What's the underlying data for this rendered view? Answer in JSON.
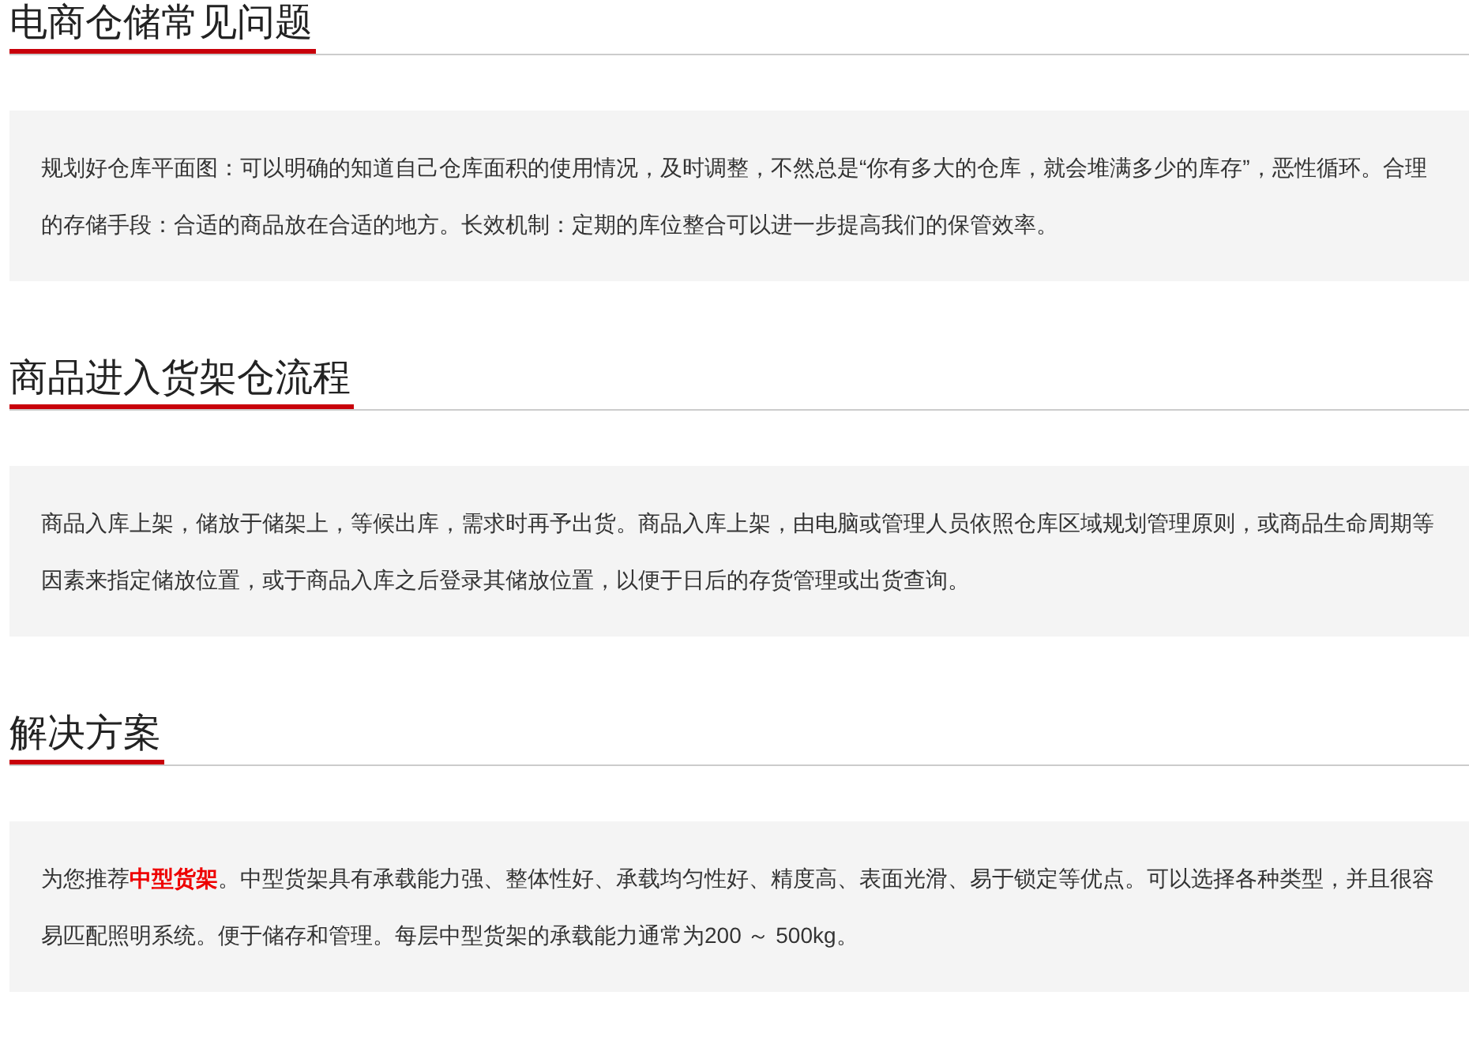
{
  "sections": [
    {
      "heading": "电商仓储常见问题",
      "text": "规划好仓库平面图：可以明确的知道自己仓库面积的使用情况，及时调整，不然总是“你有多大的仓库，就会堆满多少的库存”，恶性循环。合理的存储手段：合适的商品放在合适的地方。长效机制：定期的库位整合可以进一步提高我们的保管效率。"
    },
    {
      "heading": "商品进入货架仓流程",
      "text": "商品入库上架，储放于储架上，等候出库，需求时再予出货。商品入库上架，由电脑或管理人员依照仓库区域规划管理原则，或商品生命周期等因素来指定储放位置，或于商品入库之后登录其储放位置，以便于日后的存货管理或出货查询。"
    },
    {
      "heading": "解决方案",
      "text": "为您推荐**中型货架**。中型货架具有承载能力强、整体性好、承载均匀性好、精度高、表面光滑、易于锁定等优点。可以选择各种类型，并且很容易匹配照明系统。便于储存和管理。每层中型货架的承载能力通常为200 ～ 500kg。"
    }
  ]
}
